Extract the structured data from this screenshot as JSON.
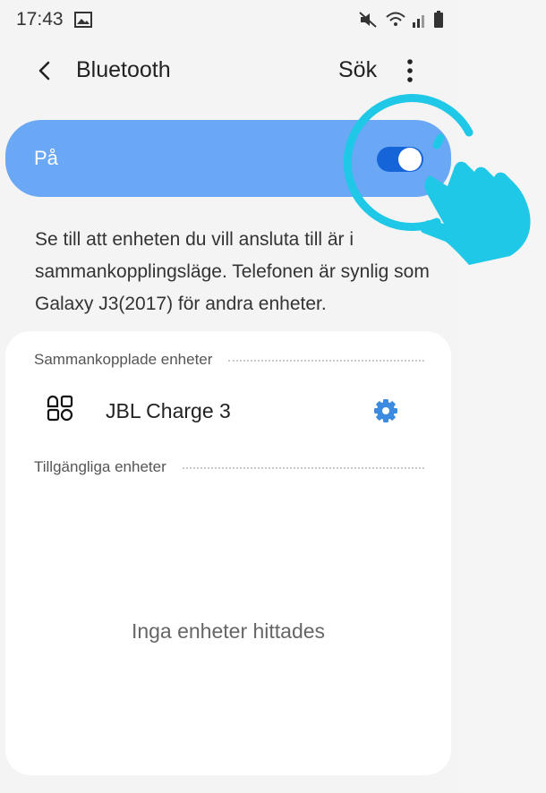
{
  "status_bar": {
    "time": "17:43",
    "icons": [
      "gallery-icon",
      "mute-icon",
      "wifi-icon",
      "signal-icon",
      "battery-icon"
    ]
  },
  "header": {
    "title": "Bluetooth",
    "search_label": "Sök",
    "icons": [
      "back-arrow-icon",
      "more-vert-icon"
    ]
  },
  "toggle": {
    "label": "På",
    "state": "on"
  },
  "description": "Se till att enheten du vill ansluta till är i sammankopplingsläge. Telefonen är synlig som Galaxy J3(2017) för andra enheter.",
  "paired_section": {
    "title": "Sammankopplade enheter",
    "devices": [
      {
        "name": "JBL Charge 3",
        "icon": "device-generic-icon"
      }
    ]
  },
  "available_section": {
    "title": "Tillgängliga enheter",
    "empty_text": "Inga enheter hittades"
  },
  "colors": {
    "accent": "#6aa8f5",
    "switch_on": "#1565d8",
    "gear": "#3d8be0",
    "tutorial": "#1ec8e6"
  }
}
